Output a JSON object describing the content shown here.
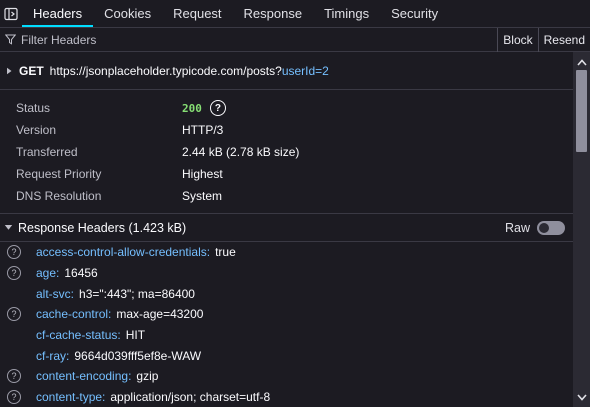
{
  "tabs": [
    {
      "label": "Headers"
    },
    {
      "label": "Cookies"
    },
    {
      "label": "Request"
    },
    {
      "label": "Response"
    },
    {
      "label": "Timings"
    },
    {
      "label": "Security"
    }
  ],
  "filter": {
    "placeholder": "Filter Headers",
    "block_label": "Block",
    "resend_label": "Resend"
  },
  "request": {
    "method": "GET",
    "url_base": "https://jsonplaceholder.typicode.com/posts?",
    "url_query": "userId=2"
  },
  "summary": [
    {
      "key": "Status",
      "value": "200"
    },
    {
      "key": "Version",
      "value": "HTTP/3"
    },
    {
      "key": "Transferred",
      "value": "2.44 kB (2.78 kB size)"
    },
    {
      "key": "Request Priority",
      "value": "Highest"
    },
    {
      "key": "DNS Resolution",
      "value": "System"
    }
  ],
  "response_headers": {
    "title": "Response Headers (1.423 kB)",
    "raw_label": "Raw",
    "raw_enabled": false,
    "items": [
      {
        "name": "access-control-allow-credentials:",
        "value": "true",
        "has_help": true
      },
      {
        "name": "age:",
        "value": "16456",
        "has_help": true
      },
      {
        "name": "alt-svc:",
        "value": "h3=\":443\"; ma=86400",
        "has_help": false
      },
      {
        "name": "cache-control:",
        "value": "max-age=43200",
        "has_help": true
      },
      {
        "name": "cf-cache-status:",
        "value": "HIT",
        "has_help": false
      },
      {
        "name": "cf-ray:",
        "value": "9664d039fff5ef8e-WAW",
        "has_help": false
      },
      {
        "name": "content-encoding:",
        "value": "gzip",
        "has_help": true
      },
      {
        "name": "content-type:",
        "value": "application/json; charset=utf-8",
        "has_help": true
      }
    ]
  },
  "colors": {
    "background": "#1c1b22",
    "header_name": "#75bfff",
    "status_ok": "#86de74",
    "selected_tab_accent": "#00ddff"
  }
}
